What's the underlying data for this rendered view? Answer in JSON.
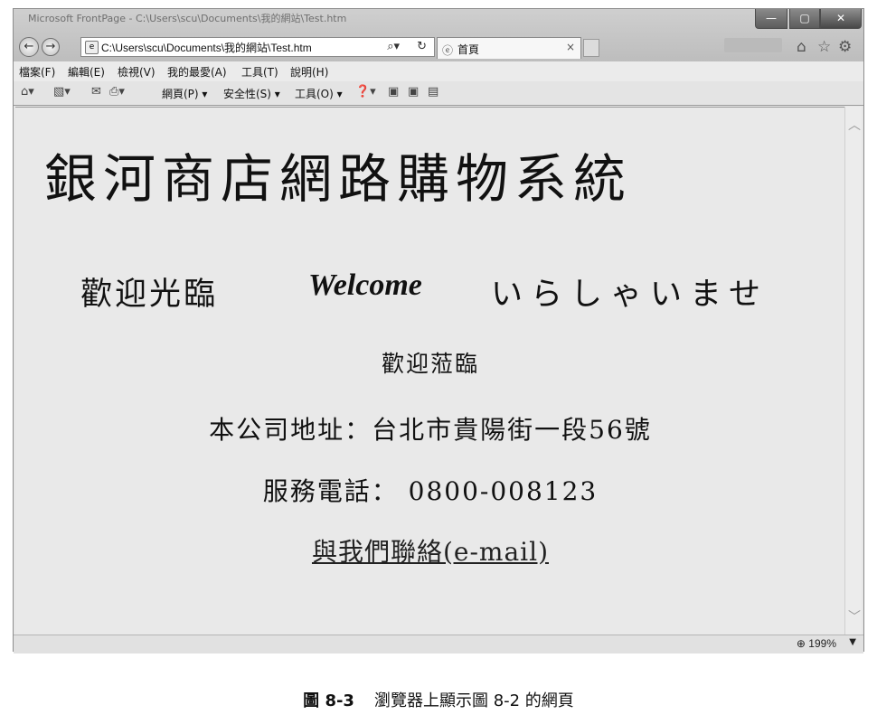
{
  "browser": {
    "title": "Microsoft FrontPage - C:\\Users\\scu\\Documents\\我的網站\\Test.htm",
    "address": "C:\\Users\\scu\\Documents\\我的網站\\Test.htm",
    "tab_label": "首頁",
    "zoom": "199%"
  },
  "menu": [
    "檔案(F)",
    "編輯(E)",
    "檢視(V)",
    "我的最愛(A)",
    "工具(T)",
    "說明(H)"
  ],
  "command_bar": {
    "page": "網頁(P)",
    "safety": "安全性(S)",
    "tools": "工具(O)"
  },
  "page": {
    "title": "銀河商店網路購物系統",
    "welcome_zh": "歡迎光臨",
    "welcome_en": "Welcome",
    "welcome_ja": "いらしゃいませ",
    "greeting": "歡迎蒞臨",
    "address": "本公司地址：台北市貴陽街一段56號",
    "phone": "服務電話： 0800-008123",
    "contact_link": "與我們聯絡(e-mail)"
  },
  "caption": {
    "number": "圖 8-3",
    "text": "瀏覽器上顯示圖 8-2 的網頁"
  }
}
